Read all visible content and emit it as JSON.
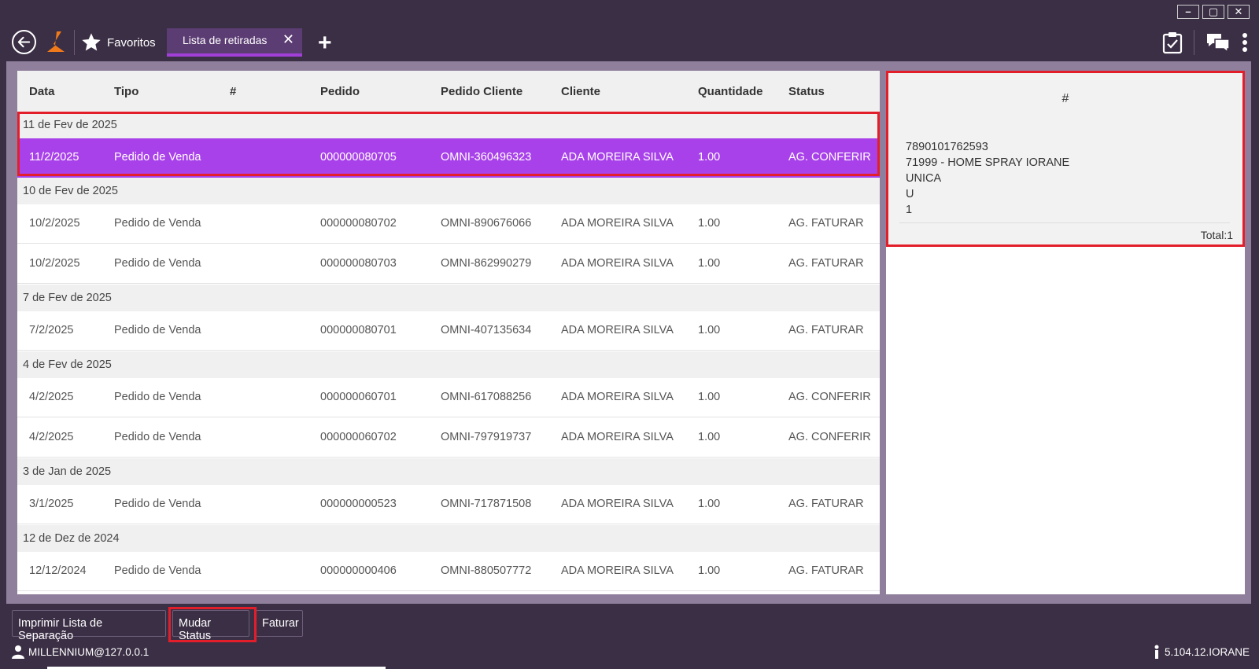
{
  "window": {
    "minimize_glyph": "–",
    "maximize_glyph": "▢",
    "close_glyph": "✕"
  },
  "tabbar": {
    "favorites_label": "Favoritos",
    "active_tab_label": "Lista de retiradas",
    "active_tab_close": "✕",
    "add_tab": "+"
  },
  "table": {
    "headers": [
      "Data",
      "Tipo",
      "#",
      "Pedido",
      "Pedido Cliente",
      "Cliente",
      "Quantidade",
      "Status"
    ],
    "groups": [
      {
        "label": "11 de Fev de 2025",
        "rows": [
          {
            "data": "11/2/2025",
            "tipo": "Pedido de Venda",
            "num": "",
            "pedido": "000000080705",
            "pedido_cliente": "OMNI-360496323",
            "cliente": "ADA MOREIRA SILVA",
            "quantidade": "1.00",
            "status": "AG. CONFERIR"
          }
        ]
      },
      {
        "label": "10 de Fev de 2025",
        "rows": [
          {
            "data": "10/2/2025",
            "tipo": "Pedido de Venda",
            "num": "",
            "pedido": "000000080702",
            "pedido_cliente": "OMNI-890676066",
            "cliente": "ADA MOREIRA SILVA",
            "quantidade": "1.00",
            "status": "AG. FATURAR"
          },
          {
            "data": "10/2/2025",
            "tipo": "Pedido de Venda",
            "num": "",
            "pedido": "000000080703",
            "pedido_cliente": "OMNI-862990279",
            "cliente": "ADA MOREIRA SILVA",
            "quantidade": "1.00",
            "status": "AG. FATURAR"
          }
        ]
      },
      {
        "label": "7 de Fev de 2025",
        "rows": [
          {
            "data": "7/2/2025",
            "tipo": "Pedido de Venda",
            "num": "",
            "pedido": "000000080701",
            "pedido_cliente": "OMNI-407135634",
            "cliente": "ADA MOREIRA SILVA",
            "quantidade": "1.00",
            "status": "AG. FATURAR"
          }
        ]
      },
      {
        "label": "4 de Fev de 2025",
        "rows": [
          {
            "data": "4/2/2025",
            "tipo": "Pedido de Venda",
            "num": "",
            "pedido": "000000060701",
            "pedido_cliente": "OMNI-617088256",
            "cliente": "ADA MOREIRA SILVA",
            "quantidade": "1.00",
            "status": "AG. CONFERIR"
          },
          {
            "data": "4/2/2025",
            "tipo": "Pedido de Venda",
            "num": "",
            "pedido": "000000060702",
            "pedido_cliente": "OMNI-797919737",
            "cliente": "ADA MOREIRA SILVA",
            "quantidade": "1.00",
            "status": "AG. CONFERIR"
          }
        ]
      },
      {
        "label": "3 de Jan de 2025",
        "rows": [
          {
            "data": "3/1/2025",
            "tipo": "Pedido de Venda",
            "num": "",
            "pedido": "000000000523",
            "pedido_cliente": "OMNI-717871508",
            "cliente": "ADA MOREIRA SILVA",
            "quantidade": "1.00",
            "status": "AG. FATURAR"
          }
        ]
      },
      {
        "label": "12 de Dez de 2024",
        "rows": [
          {
            "data": "12/12/2024",
            "tipo": "Pedido de Venda",
            "num": "",
            "pedido": "000000000406",
            "pedido_cliente": "OMNI-880507772",
            "cliente": "ADA MOREIRA SILVA",
            "quantidade": "1.00",
            "status": "AG. FATURAR"
          }
        ]
      }
    ]
  },
  "detail": {
    "header": "#",
    "lines": [
      "7890101762593",
      "71999 - HOME SPRAY IORANE",
      "UNICA",
      "U",
      "1"
    ],
    "total": "Total:1"
  },
  "footer": {
    "print_button": "Imprimir Lista de Separação",
    "change_status_button": "Mudar Status",
    "invoice_button": "Faturar"
  },
  "status": {
    "user": "MILLENNIUM@127.0.0.1",
    "version": "5.104.12.IORANE"
  },
  "colors": {
    "selected_row": "#a941ea",
    "highlight_box": "#e31e2b",
    "chrome_bg": "#3b2f45"
  }
}
